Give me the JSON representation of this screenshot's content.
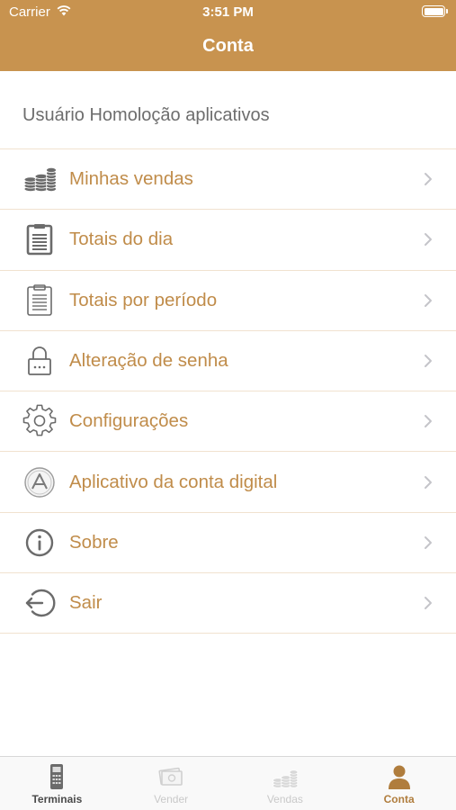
{
  "status_bar": {
    "carrier": "Carrier",
    "time": "3:51 PM"
  },
  "nav": {
    "title": "Conta"
  },
  "user": {
    "name": "Usuário Homoloção aplicativos"
  },
  "menu": [
    {
      "label": "Minhas vendas",
      "icon": "coins-stack-icon"
    },
    {
      "label": "Totais do dia",
      "icon": "clipboard-icon"
    },
    {
      "label": "Totais por período",
      "icon": "clipboard-period-icon"
    },
    {
      "label": "Alteração de senha",
      "icon": "lock-icon"
    },
    {
      "label": "Configurações",
      "icon": "gear-icon"
    },
    {
      "label": "Aplicativo da conta digital",
      "icon": "app-logo-icon"
    },
    {
      "label": "Sobre",
      "icon": "info-icon"
    },
    {
      "label": "Sair",
      "icon": "logout-icon"
    }
  ],
  "tabs": [
    {
      "label": "Terminais",
      "state": "normal"
    },
    {
      "label": "Vender",
      "state": "disabled"
    },
    {
      "label": "Vendas",
      "state": "disabled"
    },
    {
      "label": "Conta",
      "state": "selected"
    }
  ],
  "colors": {
    "accent": "#c8934f",
    "label": "#c08c4a",
    "separator": "#f1e2cf"
  }
}
